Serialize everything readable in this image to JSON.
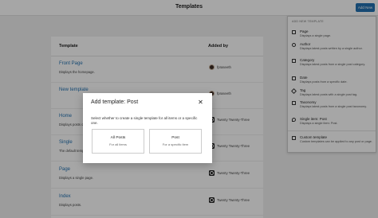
{
  "header": {
    "title": "Templates",
    "add_new": "Add New"
  },
  "table": {
    "col_template": "Template",
    "col_added_by": "Added by",
    "rows": [
      {
        "title": "Front Page",
        "desc": "Displays the homepage.",
        "added_by": "fpraseeth",
        "kind": "avatar"
      },
      {
        "title": "New template",
        "desc": "",
        "added_by": "fpraseeth",
        "kind": "avatar"
      },
      {
        "title": "Home",
        "desc": "Displays posts on the homepage",
        "added_by": "Twenty Twenty-Three",
        "kind": "theme"
      },
      {
        "title": "Single",
        "desc": "The default template...",
        "added_by": "Twenty Twenty-Three",
        "kind": "theme"
      },
      {
        "title": "Page",
        "desc": "Displays a single page.",
        "added_by": "Twenty Twenty-Three",
        "kind": "theme"
      },
      {
        "title": "Index",
        "desc": "Displays posts.",
        "added_by": "Twenty Twenty-Three",
        "kind": "theme"
      }
    ]
  },
  "menu": {
    "heading": "ADD NEW TEMPLATE",
    "items": [
      {
        "label": "Page",
        "desc": "Displays a single page.",
        "icon": "page-icon"
      },
      {
        "label": "Author",
        "desc": "Displays latest posts written by a single author.",
        "icon": "author-icon"
      },
      {
        "label": "Category",
        "desc": "Displays latest posts from a single post category.",
        "icon": "category-icon"
      },
      {
        "label": "Date",
        "desc": "Displays posts from a specific date.",
        "icon": "calendar-icon"
      },
      {
        "label": "Tag",
        "desc": "Displays latest posts with a single post tag.",
        "icon": "tag-icon"
      },
      {
        "label": "Taxonomy",
        "desc": "Displays latest posts from a single post taxonomy.",
        "icon": "taxonomy-icon"
      },
      {
        "label": "Single item: Post",
        "desc": "Displays a single item: Post.",
        "icon": "pin-icon"
      },
      {
        "label": "Custom template",
        "desc": "Custom templates can be applied to any post or page.",
        "icon": "custom-template-icon"
      }
    ]
  },
  "modal": {
    "title": "Add template: Post",
    "close": "✕",
    "desc": "Select whether to create a single template for all items or a specific one.",
    "options": [
      {
        "title": "All Posts",
        "sub": "For all items"
      },
      {
        "title": "Post",
        "sub": "For a specific item"
      }
    ]
  }
}
